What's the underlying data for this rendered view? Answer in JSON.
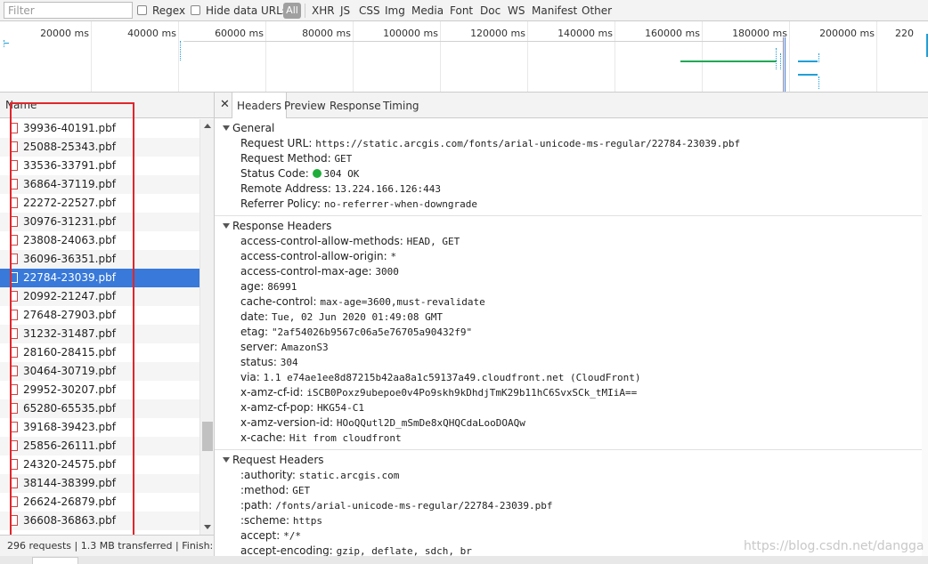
{
  "filterbar": {
    "placeholder": "Filter",
    "regex_label": "Regex",
    "hide_data_urls_label": "Hide data URLs",
    "all_label": "All",
    "types": [
      "XHR",
      "JS",
      "CSS",
      "Img",
      "Media",
      "Font",
      "Doc",
      "WS",
      "Manifest",
      "Other"
    ]
  },
  "timeline": {
    "ticks": [
      "20000 ms",
      "40000 ms",
      "60000 ms",
      "80000 ms",
      "100000 ms",
      "120000 ms",
      "140000 ms",
      "160000 ms",
      "180000 ms",
      "200000 ms",
      "220"
    ]
  },
  "list": {
    "header": "Name",
    "items": [
      "39936-40191.pbf",
      "25088-25343.pbf",
      "33536-33791.pbf",
      "36864-37119.pbf",
      "22272-22527.pbf",
      "30976-31231.pbf",
      "23808-24063.pbf",
      "36096-36351.pbf",
      "22784-23039.pbf",
      "20992-21247.pbf",
      "27648-27903.pbf",
      "31232-31487.pbf",
      "28160-28415.pbf",
      "30464-30719.pbf",
      "29952-30207.pbf",
      "65280-65535.pbf",
      "39168-39423.pbf",
      "25856-26111.pbf",
      "24320-24575.pbf",
      "38144-38399.pbf",
      "26624-26879.pbf",
      "36608-36863.pbf"
    ],
    "selected": "22784-23039.pbf"
  },
  "status": {
    "text": "296 requests  |  1.3 MB transferred  |  Finish:..."
  },
  "detail": {
    "tabs": [
      "Headers",
      "Preview",
      "Response",
      "Timing"
    ],
    "active_tab": "Headers",
    "general": {
      "title": "General",
      "rows": [
        {
          "k": "Request URL:",
          "v": "https://static.arcgis.com/fonts/arial-unicode-ms-regular/22784-23039.pbf"
        },
        {
          "k": "Request Method:",
          "v": "GET"
        },
        {
          "k": "Status Code:",
          "v": "304 OK"
        },
        {
          "k": "Remote Address:",
          "v": "13.224.166.126:443"
        },
        {
          "k": "Referrer Policy:",
          "v": "no-referrer-when-downgrade"
        }
      ]
    },
    "response_headers": {
      "title": "Response Headers",
      "rows": [
        {
          "k": "access-control-allow-methods:",
          "v": "HEAD, GET"
        },
        {
          "k": "access-control-allow-origin:",
          "v": "*"
        },
        {
          "k": "access-control-max-age:",
          "v": "3000"
        },
        {
          "k": "age:",
          "v": "86991"
        },
        {
          "k": "cache-control:",
          "v": "max-age=3600,must-revalidate"
        },
        {
          "k": "date:",
          "v": "Tue, 02 Jun 2020 01:49:08 GMT"
        },
        {
          "k": "etag:",
          "v": "\"2af54026b9567c06a5e76705a90432f9\""
        },
        {
          "k": "server:",
          "v": "AmazonS3"
        },
        {
          "k": "status:",
          "v": "304"
        },
        {
          "k": "via:",
          "v": "1.1 e74ae1ee8d87215b42aa8a1c59137a49.cloudfront.net (CloudFront)"
        },
        {
          "k": "x-amz-cf-id:",
          "v": "iSCB0Poxz9ubepoe0v4Po9skh9kDhdjTmK29b11hC6SvxSCk_tMIiA=="
        },
        {
          "k": "x-amz-cf-pop:",
          "v": "HKG54-C1"
        },
        {
          "k": "x-amz-version-id:",
          "v": "HOoQQutl2D_mSmDe8xQHQCdaLooDOAQw"
        },
        {
          "k": "x-cache:",
          "v": "Hit from cloudfront"
        }
      ]
    },
    "request_headers": {
      "title": "Request Headers",
      "rows": [
        {
          "k": ":authority:",
          "v": "static.arcgis.com"
        },
        {
          "k": ":method:",
          "v": "GET"
        },
        {
          "k": ":path:",
          "v": "/fonts/arial-unicode-ms-regular/22784-23039.pbf"
        },
        {
          "k": ":scheme:",
          "v": "https"
        },
        {
          "k": "accept:",
          "v": "*/*"
        },
        {
          "k": "accept-encoding:",
          "v": "gzip, deflate, sdch, br"
        }
      ]
    }
  },
  "watermark": "https://blog.csdn.net/dangga",
  "colors": {
    "selection": "#3879d9",
    "status_ok": "#1fae3a",
    "annotation_box": "#e0262b",
    "timeline_green": "#1fa855",
    "timeline_blue": "#1f9fd8"
  }
}
